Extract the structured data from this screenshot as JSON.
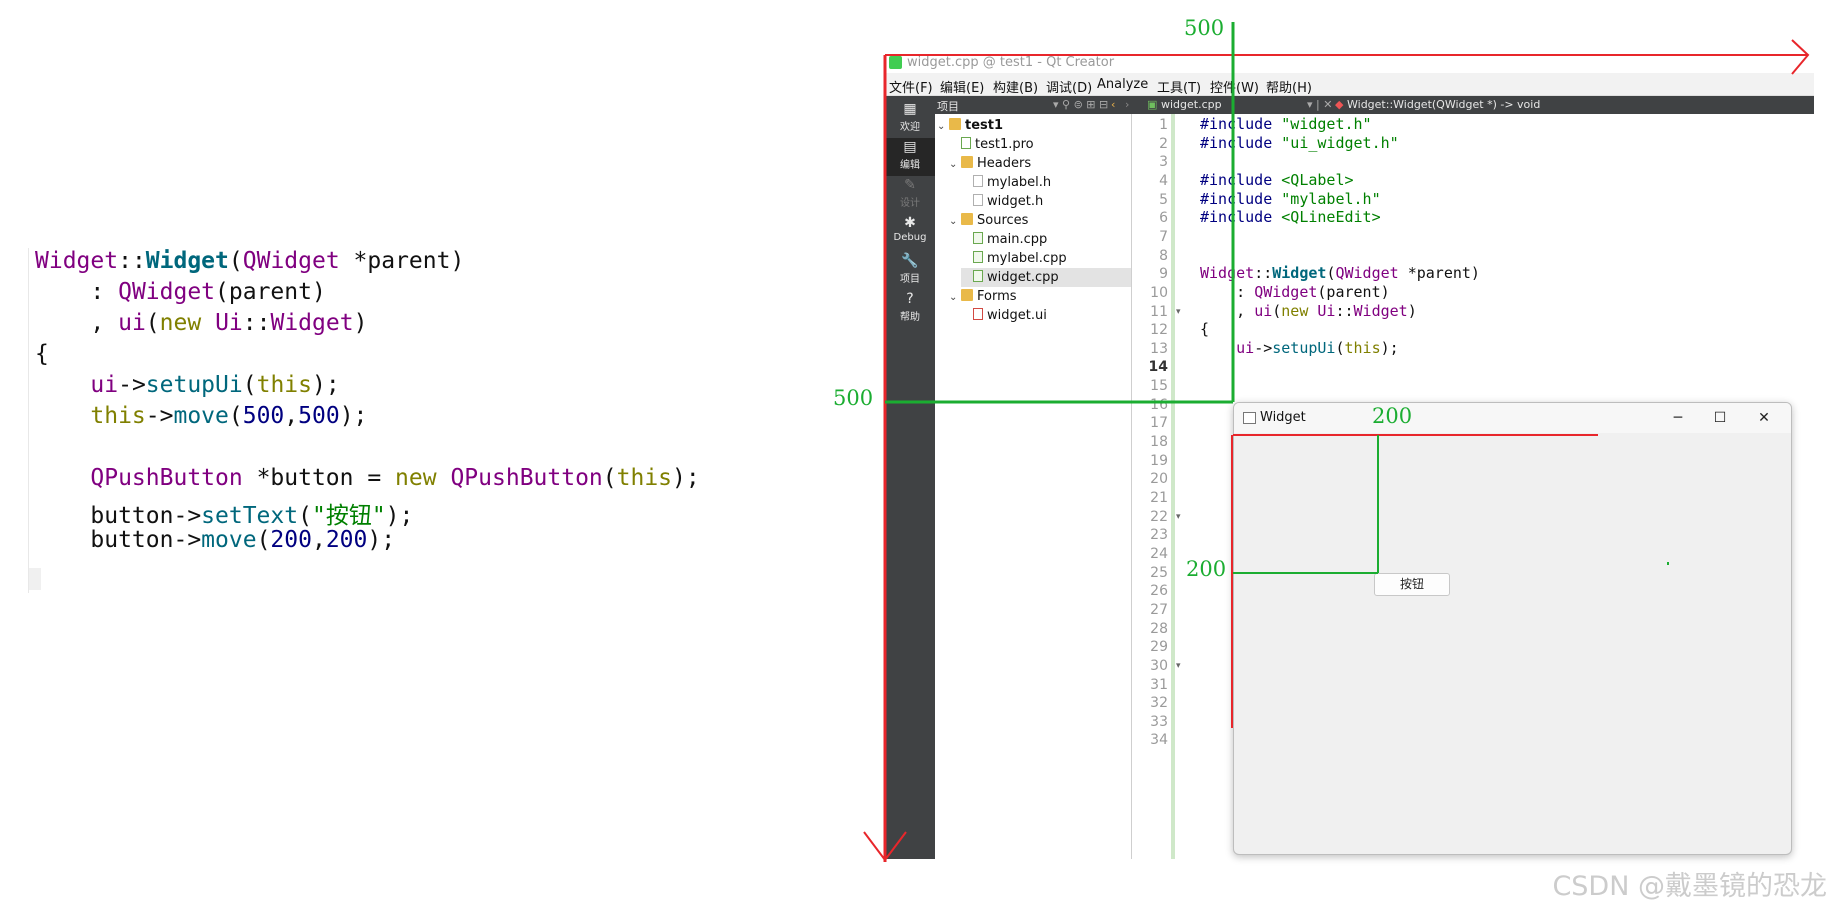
{
  "snippet": {
    "lines": [
      [
        [
          "Widget",
          "ty"
        ],
        [
          "::",
          ""
        ],
        [
          "Widget",
          "fnb"
        ],
        [
          "(",
          ""
        ],
        [
          "QWidget",
          "ty"
        ],
        [
          " *parent)",
          ""
        ]
      ],
      [
        [
          "    : ",
          ""
        ],
        [
          "QWidget",
          "ty"
        ],
        [
          "(parent)",
          ""
        ]
      ],
      [
        [
          "    , ",
          ""
        ],
        [
          "ui",
          "ty"
        ],
        [
          "(",
          ""
        ],
        [
          "new",
          "kw"
        ],
        [
          " ",
          ""
        ],
        [
          "Ui",
          "ty"
        ],
        [
          "::",
          ""
        ],
        [
          "Widget",
          "ty"
        ],
        [
          ")",
          ""
        ]
      ],
      [
        [
          "{",
          ""
        ]
      ],
      [
        [
          "    ",
          ""
        ],
        [
          "ui",
          "ty"
        ],
        [
          "->",
          ""
        ],
        [
          "setupUi",
          "fn"
        ],
        [
          "(",
          ""
        ],
        [
          "this",
          "kw"
        ],
        [
          ");",
          ""
        ]
      ],
      [
        [
          "    ",
          ""
        ],
        [
          "this",
          "kw"
        ],
        [
          "->",
          ""
        ],
        [
          "move",
          "fn"
        ],
        [
          "(",
          ""
        ],
        [
          "500",
          "num"
        ],
        [
          ",",
          ""
        ],
        [
          "500",
          "num"
        ],
        [
          ");",
          ""
        ]
      ],
      [
        [
          "",
          ""
        ]
      ],
      [
        [
          "    ",
          ""
        ],
        [
          "QPushButton",
          "ty"
        ],
        [
          " *button = ",
          ""
        ],
        [
          "new",
          "kw"
        ],
        [
          " ",
          ""
        ],
        [
          "QPushButton",
          "ty"
        ],
        [
          "(",
          ""
        ],
        [
          "this",
          "kw"
        ],
        [
          ");",
          ""
        ]
      ],
      [
        [
          "    button->",
          ""
        ],
        [
          "setText",
          "fn"
        ],
        [
          "(",
          ""
        ],
        [
          "\"按钮\"",
          "str"
        ],
        [
          ");",
          ""
        ]
      ],
      [
        [
          "    button->",
          ""
        ],
        [
          "move",
          "fn"
        ],
        [
          "(",
          ""
        ],
        [
          "200",
          "num"
        ],
        [
          ",",
          ""
        ],
        [
          "200",
          "num"
        ],
        [
          ");",
          ""
        ]
      ]
    ]
  },
  "qt": {
    "window_title": "widget.cpp @ test1 - Qt Creator",
    "menu": [
      "文件(F)",
      "编辑(E)",
      "构建(B)",
      "调试(D)",
      "Analyze",
      "工具(T)",
      "控件(W)",
      "帮助(H)"
    ],
    "toolbar": {
      "project_label": "项目",
      "file_tab": "widget.cpp",
      "symbol": "Widget::Widget(QWidget *) -> void"
    },
    "modes": [
      {
        "label": "欢迎",
        "icon": "▦",
        "state": "normal"
      },
      {
        "label": "编辑",
        "icon": "▤",
        "state": "active"
      },
      {
        "label": "设计",
        "icon": "✎",
        "state": "dim"
      },
      {
        "label": "Debug",
        "icon": "✱",
        "state": "normal"
      },
      {
        "label": "项目",
        "icon": "🔧",
        "state": "normal"
      },
      {
        "label": "帮助",
        "icon": "?",
        "state": "normal"
      }
    ],
    "tree": [
      {
        "label": "test1",
        "depth": 0,
        "kind": "folder",
        "twisty": "v",
        "bold": true
      },
      {
        "label": "test1.pro",
        "depth": 1,
        "kind": "pro",
        "twisty": ""
      },
      {
        "label": "Headers",
        "depth": 1,
        "kind": "folder",
        "twisty": "v"
      },
      {
        "label": "mylabel.h",
        "depth": 2,
        "kind": "h",
        "twisty": ""
      },
      {
        "label": "widget.h",
        "depth": 2,
        "kind": "h",
        "twisty": ""
      },
      {
        "label": "Sources",
        "depth": 1,
        "kind": "folder",
        "twisty": "v"
      },
      {
        "label": "main.cpp",
        "depth": 2,
        "kind": "cpp",
        "twisty": ""
      },
      {
        "label": "mylabel.cpp",
        "depth": 2,
        "kind": "cpp",
        "twisty": ""
      },
      {
        "label": "widget.cpp",
        "depth": 2,
        "kind": "cpp",
        "twisty": "",
        "selected": true
      },
      {
        "label": "Forms",
        "depth": 1,
        "kind": "folder",
        "twisty": "v"
      },
      {
        "label": "widget.ui",
        "depth": 2,
        "kind": "ui",
        "twisty": ""
      }
    ],
    "line_numbers": [
      "1",
      "2",
      "3",
      "4",
      "5",
      "6",
      "7",
      "8",
      "9",
      "10",
      "11",
      "12",
      "13",
      "14",
      "15",
      "16",
      "17",
      "18",
      "19",
      "20",
      "21",
      "22",
      "23",
      "24",
      "25",
      "26",
      "27",
      "28",
      "29",
      "30",
      "31",
      "32",
      "33",
      "34"
    ],
    "current_line": "14",
    "fold_markers": [
      "11",
      "22",
      "30"
    ],
    "code": [
      [
        [
          "#include ",
          "inc"
        ],
        [
          "\"widget.h\"",
          "str"
        ]
      ],
      [
        [
          "#include ",
          "inc"
        ],
        [
          "\"ui_widget.h\"",
          "str"
        ]
      ],
      [
        [
          "",
          ""
        ]
      ],
      [
        [
          "#include ",
          "inc"
        ],
        [
          "<QLabel>",
          "str"
        ]
      ],
      [
        [
          "#include ",
          "inc"
        ],
        [
          "\"mylabel.h\"",
          "str"
        ]
      ],
      [
        [
          "#include ",
          "inc"
        ],
        [
          "<QLineEdit>",
          "str"
        ]
      ],
      [
        [
          "",
          ""
        ]
      ],
      [
        [
          "",
          ""
        ]
      ],
      [
        [
          "Widget",
          "ty"
        ],
        [
          "::",
          ""
        ],
        [
          "Widget",
          "fnb"
        ],
        [
          "(",
          ""
        ],
        [
          "QWidget",
          "ty"
        ],
        [
          " *parent)",
          ""
        ]
      ],
      [
        [
          "    : ",
          ""
        ],
        [
          "QWidget",
          "ty"
        ],
        [
          "(parent)",
          ""
        ]
      ],
      [
        [
          "    , ",
          ""
        ],
        [
          "ui",
          "ty"
        ],
        [
          "(",
          ""
        ],
        [
          "new",
          "kw"
        ],
        [
          " ",
          ""
        ],
        [
          "Ui",
          "ty"
        ],
        [
          "::",
          ""
        ],
        [
          "Widget",
          "ty"
        ],
        [
          ")",
          ""
        ]
      ],
      [
        [
          "{",
          ""
        ]
      ],
      [
        [
          "    ",
          ""
        ],
        [
          "ui",
          "ty"
        ],
        [
          "->",
          ""
        ],
        [
          "setupUi",
          "fn"
        ],
        [
          "(",
          ""
        ],
        [
          "this",
          "kw"
        ],
        [
          ");",
          ""
        ]
      ]
    ]
  },
  "widget_window": {
    "title": "Widget",
    "minimize": "─",
    "maximize": "☐",
    "close": "✕",
    "button_label": "按钮"
  },
  "annotations": {
    "label_top": "500",
    "label_left": "500",
    "label_inner_top": "200",
    "label_inner_left": "200",
    "colors": {
      "red": "#e8262b",
      "green": "#1bad31"
    }
  },
  "watermark": "CSDN @戴墨镜的恐龙"
}
